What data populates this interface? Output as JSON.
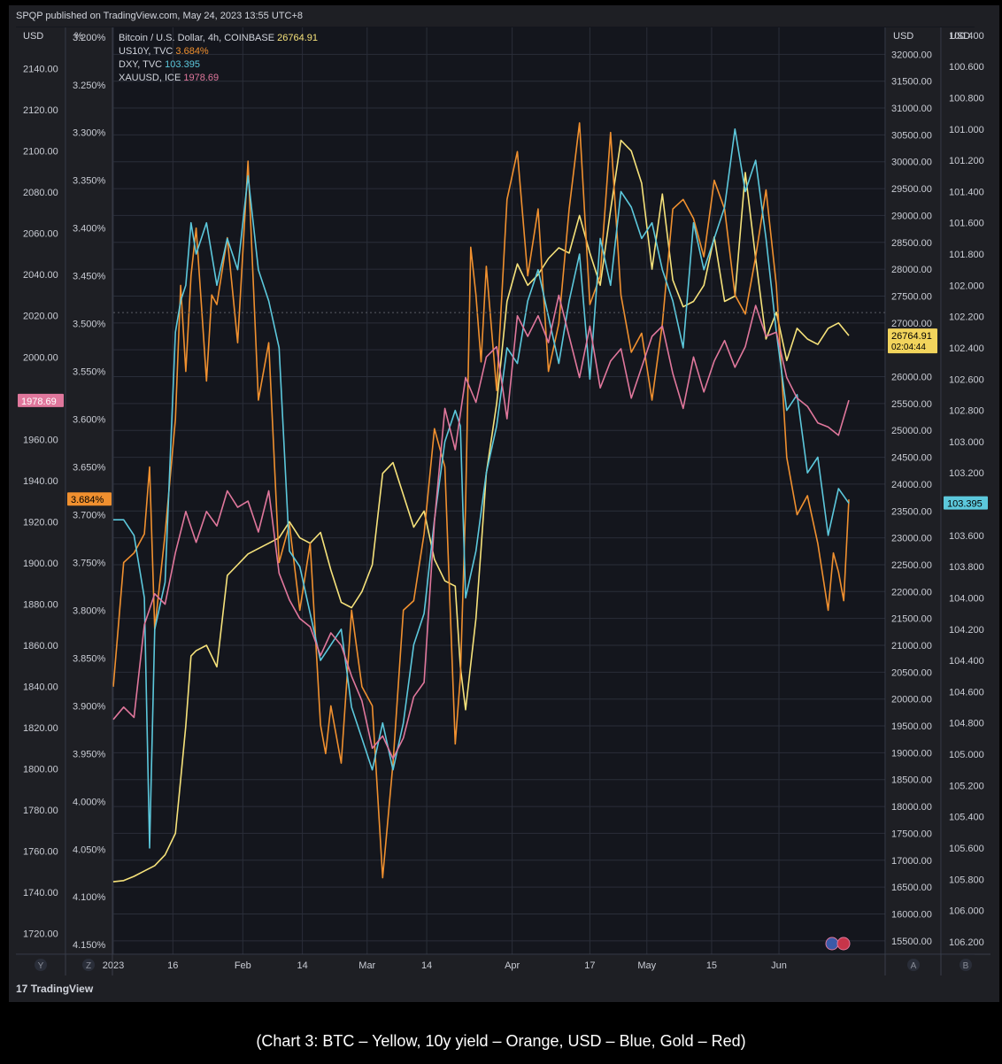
{
  "header": {
    "published": "SPQP published on TradingView.com, May 24, 2023 13:55 UTC+8"
  },
  "footer": {
    "logo": "TradingView"
  },
  "caption": "(Chart 3: BTC – Yellow, 10y yield – Orange, USD – Blue, Gold – Red)",
  "axis_units": {
    "gold": "USD",
    "yield": "%",
    "btc": "USD",
    "dxy": "USD"
  },
  "axis_buttons": [
    "Y",
    "Z",
    "A",
    "B"
  ],
  "colors": {
    "btc": "#f6e27a",
    "yield": "#f0902f",
    "dxy": "#5cc8dc",
    "gold": "#e0779c",
    "bg": "#14161d",
    "grid": "#2a2e39",
    "text": "#d1d4dc"
  },
  "chart_data": {
    "type": "line",
    "legend_position": "top-left",
    "grid": true,
    "x_ticks": [
      "2023",
      "16",
      "Feb",
      "14",
      "Mar",
      "14",
      "Apr",
      "17",
      "May",
      "15",
      "Jun"
    ],
    "axes": {
      "gold": {
        "side": "left",
        "min": 1710,
        "max": 2160,
        "ticks": [
          "1720.00",
          "1740.00",
          "1760.00",
          "1780.00",
          "1800.00",
          "1820.00",
          "1840.00",
          "1860.00",
          "1880.00",
          "1900.00",
          "1920.00",
          "1940.00",
          "1960.00",
          "1980.00",
          "2000.00",
          "2020.00",
          "2040.00",
          "2060.00",
          "2080.00",
          "2100.00",
          "2120.00",
          "2140.00"
        ]
      },
      "yield": {
        "side": "left",
        "inverted": true,
        "min": 3.19,
        "max": 4.16,
        "ticks": [
          "3.200%",
          "3.250%",
          "3.300%",
          "3.350%",
          "3.400%",
          "3.450%",
          "3.500%",
          "3.550%",
          "3.600%",
          "3.650%",
          "3.700%",
          "3.750%",
          "3.800%",
          "3.850%",
          "3.900%",
          "3.950%",
          "4.000%",
          "4.050%",
          "4.100%",
          "4.150%"
        ]
      },
      "btc": {
        "side": "right",
        "min": 15250,
        "max": 32500,
        "ticks": [
          "15500.00",
          "16000.00",
          "16500.00",
          "17000.00",
          "17500.00",
          "18000.00",
          "18500.00",
          "19000.00",
          "19500.00",
          "20000.00",
          "20500.00",
          "21000.00",
          "21500.00",
          "22000.00",
          "22500.00",
          "23000.00",
          "23500.00",
          "24000.00",
          "24500.00",
          "25000.00",
          "25500.00",
          "26000.00",
          "26500.00",
          "27000.00",
          "27500.00",
          "28000.00",
          "28500.00",
          "29000.00",
          "29500.00",
          "30000.00",
          "30500.00",
          "31000.00",
          "31500.00",
          "32000.00"
        ]
      },
      "dxy": {
        "side": "right",
        "inverted": true,
        "min": 100.35,
        "max": 106.28,
        "ticks": [
          "100.400",
          "100.600",
          "100.800",
          "101.000",
          "101.200",
          "101.400",
          "101.600",
          "101.800",
          "102.000",
          "102.200",
          "102.400",
          "102.600",
          "102.800",
          "103.000",
          "103.200",
          "103.400",
          "103.600",
          "103.800",
          "104.000",
          "104.200",
          "104.400",
          "104.600",
          "104.800",
          "105.000",
          "105.200",
          "105.400",
          "105.600",
          "105.800",
          "106.000",
          "106.200"
        ]
      }
    },
    "last_values": {
      "gold": "1978.69",
      "yield": "3.684%",
      "btc": "26764.91",
      "btc_countdown": "02:04:44",
      "dxy": "103.395"
    },
    "series": [
      {
        "name": "Bitcoin / U.S. Dollar, 4h, COINBASE",
        "value_label": "26764.91",
        "axis": "btc",
        "x": [
          0,
          2,
          4,
          6,
          8,
          10,
          12,
          13,
          14,
          15,
          16,
          18,
          20,
          22,
          24,
          26,
          28,
          30,
          32,
          34,
          36,
          38,
          40,
          42,
          44,
          46,
          48,
          50,
          52,
          54,
          56,
          58,
          60,
          62,
          64,
          66,
          67,
          68,
          70,
          71,
          72,
          74,
          76,
          78,
          80,
          82,
          84,
          86,
          88,
          90,
          92,
          94,
          96,
          98,
          100,
          102,
          104,
          106,
          108,
          110,
          112,
          114,
          116,
          118,
          120,
          122,
          124,
          126,
          128,
          130,
          132,
          134,
          136,
          138,
          140,
          142
        ],
        "values": [
          16600,
          16620,
          16700,
          16800,
          16900,
          17100,
          17500,
          18500,
          19500,
          20800,
          20900,
          21000,
          20600,
          22300,
          22500,
          22700,
          22800,
          22900,
          23000,
          23300,
          23000,
          22900,
          23100,
          22400,
          21800,
          21700,
          22000,
          22500,
          24200,
          24400,
          23800,
          23200,
          23500,
          22600,
          22200,
          22100,
          20600,
          19800,
          21500,
          22800,
          24200,
          25500,
          27400,
          28100,
          27700,
          27900,
          28200,
          28400,
          28300,
          29000,
          28300,
          27700,
          29100,
          30400,
          30200,
          29600,
          28000,
          29400,
          27800,
          27300,
          27400,
          27700,
          28600,
          27400,
          27500,
          29800,
          28200,
          26700,
          27200,
          26300,
          26900,
          26700,
          26600,
          26900,
          27000,
          26765
        ]
      },
      {
        "name": "US10Y, TVC",
        "value_label": "3.684%",
        "axis": "yield",
        "x": [
          0,
          2,
          4,
          6,
          7,
          8,
          10,
          12,
          13,
          14,
          15,
          16,
          17,
          18,
          19,
          20,
          22,
          24,
          26,
          28,
          30,
          32,
          34,
          36,
          38,
          40,
          41,
          42,
          44,
          46,
          48,
          50,
          52,
          54,
          56,
          58,
          60,
          62,
          64,
          66,
          67,
          68,
          69,
          70,
          71,
          72,
          74,
          76,
          78,
          80,
          82,
          84,
          86,
          88,
          90,
          92,
          94,
          96,
          98,
          100,
          102,
          104,
          106,
          108,
          110,
          112,
          114,
          116,
          118,
          120,
          122,
          124,
          126,
          128,
          130,
          132,
          134,
          136,
          138,
          139,
          140,
          141,
          142
        ],
        "values": [
          3.88,
          3.75,
          3.74,
          3.72,
          3.65,
          3.82,
          3.72,
          3.6,
          3.46,
          3.55,
          3.45,
          3.4,
          3.48,
          3.56,
          3.47,
          3.48,
          3.41,
          3.52,
          3.33,
          3.58,
          3.52,
          3.75,
          3.71,
          3.8,
          3.73,
          3.92,
          3.95,
          3.9,
          3.96,
          3.8,
          3.88,
          3.9,
          4.08,
          3.96,
          3.8,
          3.79,
          3.72,
          3.61,
          3.65,
          3.94,
          3.87,
          3.69,
          3.42,
          3.47,
          3.54,
          3.44,
          3.57,
          3.37,
          3.32,
          3.45,
          3.38,
          3.55,
          3.5,
          3.38,
          3.29,
          3.48,
          3.45,
          3.3,
          3.47,
          3.53,
          3.51,
          3.58,
          3.5,
          3.38,
          3.37,
          3.39,
          3.43,
          3.35,
          3.38,
          3.47,
          3.49,
          3.43,
          3.36,
          3.46,
          3.64,
          3.7,
          3.68,
          3.73,
          3.8,
          3.74,
          3.76,
          3.79,
          3.684
        ]
      },
      {
        "name": "DXY, TVC",
        "value_label": "103.395",
        "axis": "dxy",
        "x": [
          0,
          2,
          4,
          6,
          7,
          8,
          10,
          12,
          13,
          14,
          15,
          16,
          18,
          20,
          22,
          24,
          26,
          28,
          30,
          32,
          34,
          36,
          38,
          40,
          42,
          44,
          46,
          48,
          50,
          52,
          54,
          56,
          58,
          60,
          62,
          64,
          66,
          67,
          68,
          70,
          72,
          74,
          76,
          78,
          80,
          82,
          84,
          86,
          88,
          90,
          92,
          94,
          96,
          98,
          100,
          102,
          104,
          106,
          108,
          110,
          112,
          114,
          116,
          118,
          120,
          122,
          124,
          126,
          128,
          130,
          132,
          134,
          136,
          138,
          140,
          142
        ],
        "values": [
          103.5,
          103.5,
          103.6,
          104.0,
          105.6,
          104.2,
          103.9,
          102.3,
          102.1,
          102.0,
          101.6,
          101.8,
          101.6,
          102.0,
          101.7,
          101.9,
          101.3,
          101.9,
          102.1,
          102.4,
          103.7,
          103.8,
          104.1,
          104.4,
          104.3,
          104.2,
          104.7,
          104.9,
          105.1,
          104.8,
          105.1,
          104.8,
          104.3,
          104.1,
          103.5,
          103.0,
          102.8,
          102.9,
          104.0,
          103.7,
          103.2,
          102.9,
          102.4,
          102.5,
          102.1,
          101.9,
          102.2,
          102.5,
          102.1,
          101.8,
          102.6,
          101.7,
          102.0,
          101.4,
          101.5,
          101.7,
          101.6,
          101.9,
          102.1,
          102.4,
          101.6,
          101.9,
          101.7,
          101.5,
          101.0,
          101.4,
          101.2,
          101.7,
          102.3,
          102.8,
          102.7,
          103.2,
          103.1,
          103.6,
          103.3,
          103.395
        ]
      },
      {
        "name": "XAUUSD, ICE",
        "value_label": "1978.69",
        "axis": "gold",
        "x": [
          0,
          2,
          4,
          6,
          8,
          10,
          12,
          14,
          16,
          18,
          20,
          22,
          24,
          26,
          28,
          30,
          32,
          34,
          36,
          38,
          40,
          42,
          44,
          46,
          48,
          50,
          52,
          54,
          56,
          58,
          60,
          62,
          64,
          66,
          68,
          70,
          72,
          74,
          76,
          78,
          80,
          82,
          84,
          86,
          88,
          90,
          92,
          94,
          96,
          98,
          100,
          102,
          104,
          106,
          108,
          110,
          112,
          114,
          116,
          118,
          120,
          122,
          124,
          126,
          128,
          130,
          132,
          134,
          136,
          138,
          140,
          142
        ],
        "values": [
          1824,
          1830,
          1825,
          1870,
          1885,
          1880,
          1905,
          1925,
          1910,
          1925,
          1918,
          1935,
          1927,
          1930,
          1915,
          1935,
          1895,
          1882,
          1873,
          1869,
          1855,
          1866,
          1860,
          1845,
          1833,
          1810,
          1816,
          1805,
          1815,
          1835,
          1842,
          1920,
          1975,
          1955,
          1990,
          1978,
          2000,
          2005,
          1970,
          2020,
          2010,
          2020,
          2007,
          2030,
          2010,
          1990,
          2015,
          1985,
          1998,
          2004,
          1980,
          1995,
          2010,
          2015,
          1992,
          1975,
          2000,
          1983,
          1998,
          2008,
          1995,
          2005,
          2025,
          2010,
          2012,
          1990,
          1980,
          1976,
          1968,
          1966,
          1962,
          1979
        ]
      }
    ]
  }
}
